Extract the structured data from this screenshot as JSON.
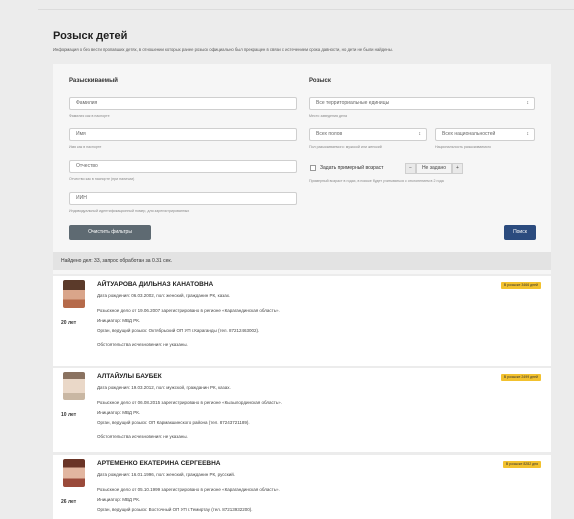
{
  "title": "Розыск детей",
  "subtitle": "Информация о без вести пропавших детях, в отношении которых ранее розыск официально был прекращен в связи с истечением срока давности, но дети не были найдены.",
  "filters": {
    "wanted_heading": "Разыскиваемый",
    "search_heading": "Розыск",
    "surname_placeholder": "Фамилия",
    "surname_hint": "Фамилия как в паспорте",
    "name_placeholder": "Имя",
    "name_hint": "Имя как в паспорте",
    "patronymic_placeholder": "Отчество",
    "patronymic_hint": "Отчество как в паспорте (при наличии)",
    "iin_placeholder": "ИИН",
    "iin_hint": "Индивидуальный идентификационный номер, для зарегистрированных",
    "region_value": "Все территориальные единицы",
    "region_hint": "Место заведения дела",
    "gender_value": "Всех полов",
    "gender_hint": "Пол разыскиваемого: мужской или женский",
    "nationality_value": "Всех национальностей",
    "nationality_hint": "Национальность разыскиваемого",
    "age_checkbox_label": "Задать примерный возраст",
    "age_minus": "−",
    "age_value": "Не задано",
    "age_plus": "+",
    "age_hint": "Примерный возраст в годах, в поиске будет учитываться с отклонением в 2 года",
    "clear_label": "Очистить фильтры",
    "search_label": "Поиск"
  },
  "found_text": "Найдено дел: 33, запрос обработан за 0.31 сек.",
  "records": [
    {
      "name": "АЙТУАРОВА ДИЛЬНАЗ КАНАТОВНА",
      "badge": "В розыске 3466 дней",
      "age": "20 лет",
      "born": "Дата рождения: 06.03.2002, пол: женский, гражданин РК, казах.",
      "case": "Розыскное дело от 19.06.2007 зарегистрировано в регионе «Карагандинская область».",
      "initiator": "Инициатор: МВД РК.",
      "agency": "Орган, ведущий розыск: Октябрьский ОП УП г.Караганды (тел. 87212463002).",
      "circumstances": "Обстоятельства исчезновения: не указаны.",
      "photo_color": "#b56a4a"
    },
    {
      "name": "АЛТАЙУЛЫ БАУБЕК",
      "badge": "В розыске 2499 дней",
      "age": "10 лет",
      "born": "Дата рождения: 19.03.2012, пол: мужской, гражданин РК, казах.",
      "case": "Розыскное дело от 06.08.2015 зарегистрировано в регионе «Кызылординская область».",
      "initiator": "Инициатор: МВД РК.",
      "agency": "Орган, ведущий розыск: ОП Кармакшинского района (тел. 87243721189).",
      "circumstances": "Обстоятельства исчезновения: не указаны.",
      "photo_color": "#c9b7a3"
    },
    {
      "name": "АРТЕМЕНКО ЕКАТЕРИНА СЕРГЕЕВНА",
      "badge": "В розыске 8282 дня",
      "age": "26 лет",
      "born": "Дата рождения: 16.01.1996, пол: женский, гражданин РК, русский.",
      "case": "Розыскное дело от 05.10.1999 зарегистрировано в регионе «Карагандинская область».",
      "initiator": "Инициатор: МВД РК.",
      "agency": "Орган, ведущий розыск: Восточный ОП УП г.Темиртау (тел. 87213932200).",
      "circumstances": "",
      "photo_color": "#9a4a3a"
    }
  ]
}
